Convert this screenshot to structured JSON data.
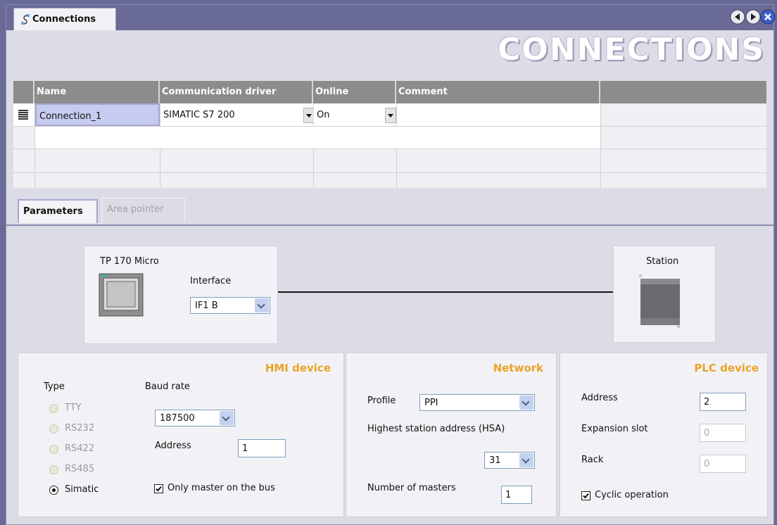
{
  "window": {
    "tab_title": "Connections",
    "banner": "CONNECTIONS"
  },
  "colors": {
    "accent": "#eaa326",
    "header": "#8c8c8c",
    "chrome": "#6a6a96"
  },
  "icons": {
    "nav_back": "circle-arrow-left-icon",
    "nav_forward": "circle-arrow-right-icon",
    "close": "circle-close-icon"
  },
  "table": {
    "headers": [
      "Name",
      "Communication driver",
      "Online",
      "Comment"
    ],
    "rows": [
      {
        "name": "Connection_1",
        "driver": "SIMATIC S7 200",
        "online": "On",
        "comment": ""
      }
    ]
  },
  "subtabs": [
    "Parameters",
    "Area pointer"
  ],
  "diagram": {
    "device": "TP 170 Micro",
    "interface_label": "Interface",
    "interface_value": "IF1 B",
    "station": "Station"
  },
  "hmi": {
    "title": "HMI device",
    "type_label": "Type",
    "types": [
      "TTY",
      "RS232",
      "RS422",
      "RS485",
      "Simatic"
    ],
    "selected_type": "Simatic",
    "baud_label": "Baud rate",
    "baud_value": "187500",
    "address_label": "Address",
    "address_value": "1",
    "master_label": "Only master on the bus",
    "master_checked": true
  },
  "network": {
    "title": "Network",
    "profile_label": "Profile",
    "profile_value": "PPI",
    "hsa_label": "Highest station address (HSA)",
    "hsa_value": "31",
    "masters_label": "Number of masters",
    "masters_value": "1"
  },
  "plc": {
    "title": "PLC device",
    "address_label": "Address",
    "address_value": "2",
    "slot_label": "Expansion slot",
    "slot_value": "0",
    "rack_label": "Rack",
    "rack_value": "0",
    "cyclic_label": "Cyclic operation",
    "cyclic_checked": true
  }
}
